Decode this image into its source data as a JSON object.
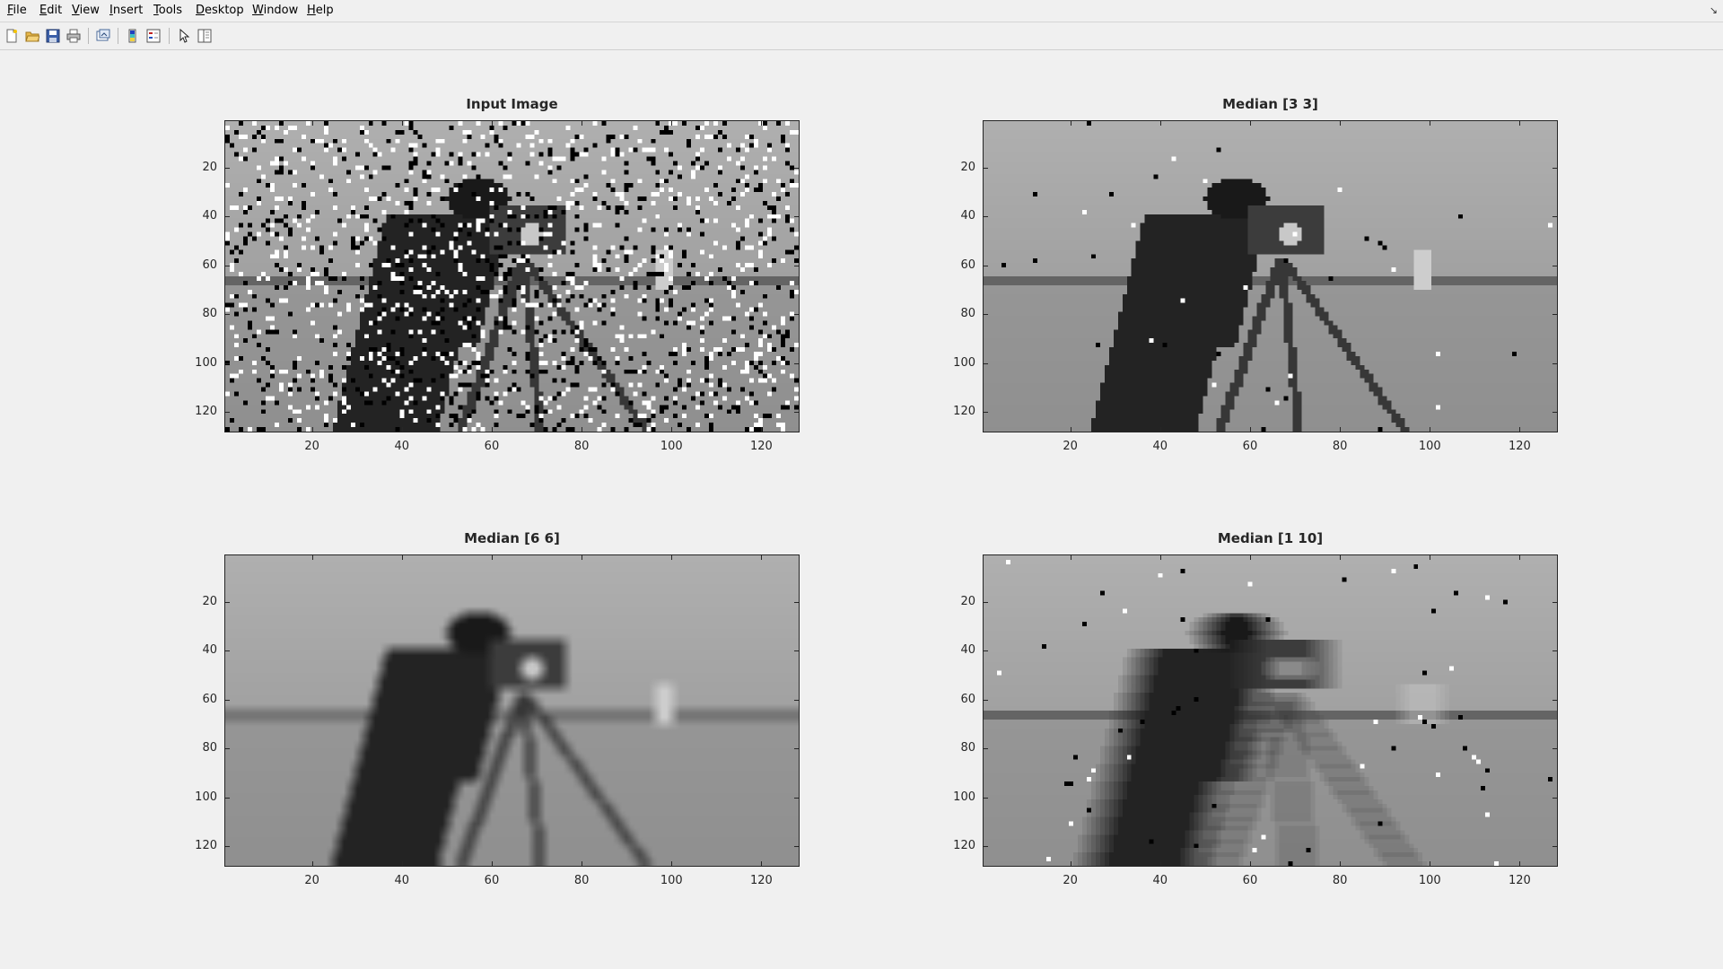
{
  "menubar": {
    "items": [
      {
        "label": "File",
        "acc": "F",
        "rest": "ile"
      },
      {
        "label": "Edit",
        "acc": "E",
        "rest": "dit"
      },
      {
        "label": "View",
        "acc": "V",
        "rest": "iew"
      },
      {
        "label": "Insert",
        "acc": "I",
        "rest": "nsert"
      },
      {
        "label": "Tools",
        "acc": "T",
        "rest": "ools"
      },
      {
        "label": "Desktop",
        "acc": "D",
        "rest": "esktop"
      },
      {
        "label": "Window",
        "acc": "W",
        "rest": "indow"
      },
      {
        "label": "Help",
        "acc": "H",
        "rest": "elp"
      }
    ],
    "undock_icon": "undock-arrow-icon"
  },
  "toolbar": {
    "icons": [
      "new-figure-icon",
      "open-file-icon",
      "save-icon",
      "print-icon",
      "link-plot-icon",
      "colorbar-icon",
      "legend-icon",
      "pointer-icon",
      "property-editor-icon"
    ]
  },
  "axes": [
    {
      "title": "Input Image",
      "image": "cameraman with salt-and-pepper noise",
      "yticks": [
        "20",
        "40",
        "60",
        "80",
        "100",
        "120"
      ],
      "xticks": [
        "20",
        "40",
        "60",
        "80",
        "100",
        "120"
      ]
    },
    {
      "title": "Median [3 3]",
      "image": "cameraman median filtered 3x3",
      "yticks": [
        "20",
        "40",
        "60",
        "80",
        "100",
        "120"
      ],
      "xticks": [
        "20",
        "40",
        "60",
        "80",
        "100",
        "120"
      ]
    },
    {
      "title": "Median [6 6]",
      "image": "cameraman median filtered 6x6",
      "yticks": [
        "20",
        "40",
        "60",
        "80",
        "100",
        "120"
      ],
      "xticks": [
        "20",
        "40",
        "60",
        "80",
        "100",
        "120"
      ]
    },
    {
      "title": "Median [1 10]",
      "image": "cameraman median filtered 1x10",
      "yticks": [
        "20",
        "40",
        "60",
        "80",
        "100",
        "120"
      ],
      "xticks": [
        "20",
        "40",
        "60",
        "80",
        "100",
        "120"
      ]
    }
  ],
  "colors": {
    "figure_bg": "#f0f0f0",
    "axis_color": "#262626"
  }
}
